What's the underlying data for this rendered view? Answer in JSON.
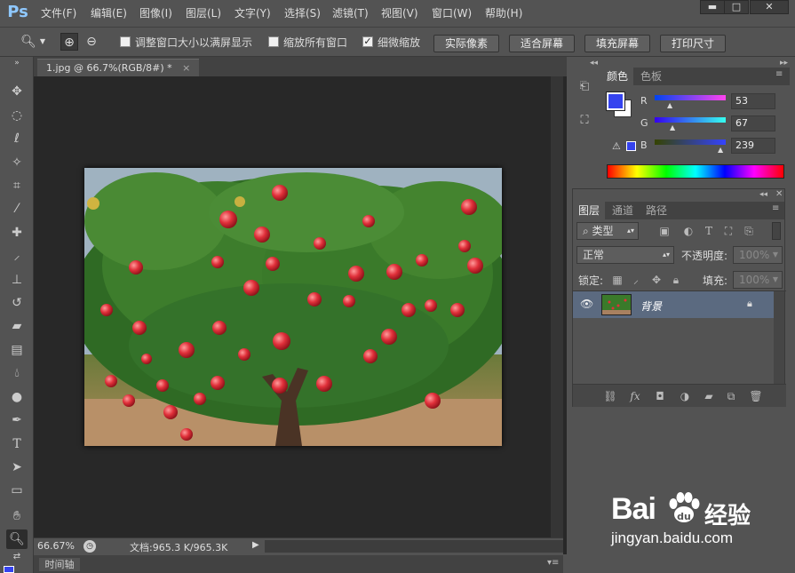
{
  "app": {
    "logo": "Ps",
    "menu": [
      "文件(F)",
      "编辑(E)",
      "图像(I)",
      "图层(L)",
      "文字(Y)",
      "选择(S)",
      "滤镜(T)",
      "视图(V)",
      "窗口(W)",
      "帮助(H)"
    ],
    "window_buttons": [
      "minimize-icon",
      "maximize-icon",
      "close-icon"
    ]
  },
  "options_bar": {
    "zoom_options": [
      {
        "label": "调整窗口大小以满屏显示",
        "checked": false
      },
      {
        "label": "缩放所有窗口",
        "checked": false
      },
      {
        "label": "细微缩放",
        "checked": true
      }
    ],
    "buttons": [
      "实际像素",
      "适合屏幕",
      "填充屏幕",
      "打印尺寸"
    ]
  },
  "document": {
    "tab_title": "1.jpg @ 66.7%(RGB/8#) *",
    "zoom": "66.67%",
    "doc_info": "文档:965.3 K/965.3K"
  },
  "timeline": {
    "label": "时间轴"
  },
  "color_panel": {
    "tabs": [
      "颜色",
      "色板"
    ],
    "active_tab": "颜色",
    "foreground": "#3543ef",
    "background": "#ffffff",
    "channels": [
      {
        "name": "R",
        "value": "53"
      },
      {
        "name": "G",
        "value": "67"
      },
      {
        "name": "B",
        "value": "239"
      }
    ]
  },
  "layers_panel": {
    "tabs": [
      "图层",
      "通道",
      "路径"
    ],
    "active_tab": "图层",
    "filter_kind": "类型",
    "blend_mode": "正常",
    "opacity_label": "不透明度:",
    "opacity_value": "100%",
    "lock_label": "锁定:",
    "fill_label": "填充:",
    "fill_value": "100%",
    "layers": [
      {
        "name": "背景",
        "locked": true,
        "visible": true
      }
    ]
  },
  "watermark": {
    "brand": "Bai",
    "brand_cn": "经验",
    "url": "jingyan.baidu.com"
  }
}
